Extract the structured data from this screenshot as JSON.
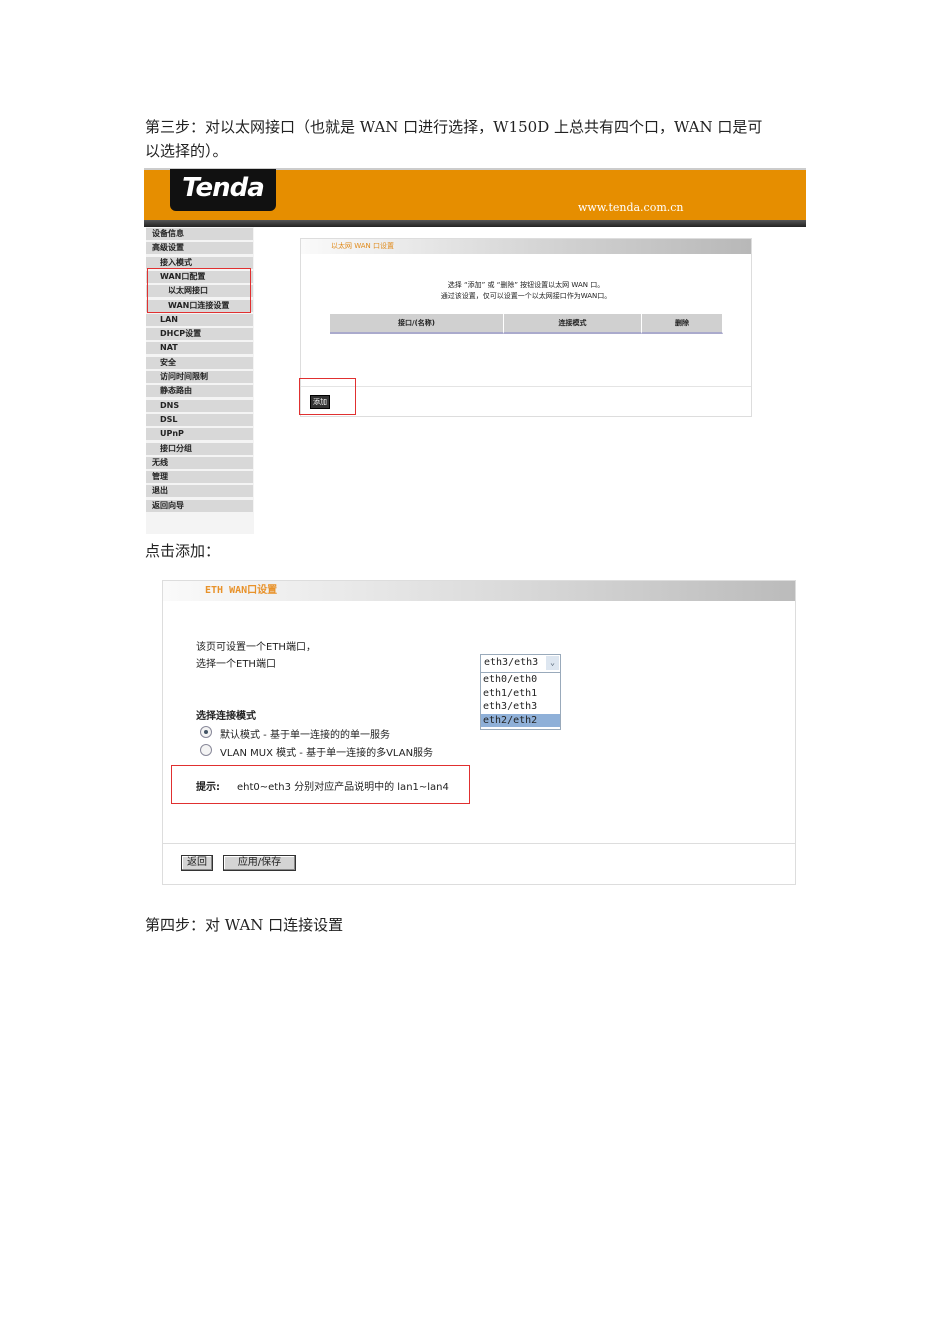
{
  "step3_text": "第三步：对以太网接口（也就是 WAN 口进行选择，W150D 上总共有四个口，WAN 口是可",
  "step3_text_cont": "以选择的）。",
  "router": {
    "logo": "Tenda",
    "url": "www.tenda.com.cn",
    "sidebar": [
      {
        "label": "设备信息",
        "level": 0
      },
      {
        "label": "高级设置",
        "level": 0
      },
      {
        "label": "接入模式",
        "level": 1
      },
      {
        "label": "WAN口配置",
        "level": 1
      },
      {
        "label": "以太网接口",
        "level": 2
      },
      {
        "label": "WAN口连接设置",
        "level": 2
      },
      {
        "label": "LAN",
        "level": 1
      },
      {
        "label": "DHCP设置",
        "level": 1
      },
      {
        "label": "NAT",
        "level": 1
      },
      {
        "label": "安全",
        "level": 1
      },
      {
        "label": "访问时间限制",
        "level": 1
      },
      {
        "label": "静态路由",
        "level": 1
      },
      {
        "label": "DNS",
        "level": 1
      },
      {
        "label": "DSL",
        "level": 1
      },
      {
        "label": "UPnP",
        "level": 1
      },
      {
        "label": "接口分组",
        "level": 1
      },
      {
        "label": "无线",
        "level": 0
      },
      {
        "label": "管理",
        "level": 0
      },
      {
        "label": "退出",
        "level": 0
      },
      {
        "label": "返回向导",
        "level": 0
      }
    ],
    "panel_title": "以太网 WAN 口设置",
    "desc1": "选择 “添加” 或 “删除” 按钮设置以太网 WAN 口。",
    "desc2": "通过该设置，仅可以设置一个以太网接口作为WAN口。",
    "columns": [
      "接口/(名称)",
      "连接模式",
      "删除"
    ],
    "add_button": "添加"
  },
  "click_add_text": "点击添加：",
  "eth": {
    "title": "ETH WAN口设置",
    "line1": "该页可设置一个ETH端口，",
    "line2": "选择一个ETH端口",
    "selected": "eth3/eth3",
    "options": [
      "eth0/eth0",
      "eth1/eth1",
      "eth3/eth3",
      "eth2/eth2"
    ],
    "mode_heading": "选择连接模式",
    "mode_default": "默认模式 - 基于单一连接的的单一服务",
    "mode_vlan": "VLAN MUX 模式 - 基于单一连接的多VLAN服务",
    "hint_label": "提示:",
    "hint_text": "eht0~eth3 分别对应产品说明中的 lan1~lan4",
    "back_button": "返回",
    "apply_button": "应用/保存"
  },
  "step4_text": "第四步：对 WAN 口连接设置"
}
